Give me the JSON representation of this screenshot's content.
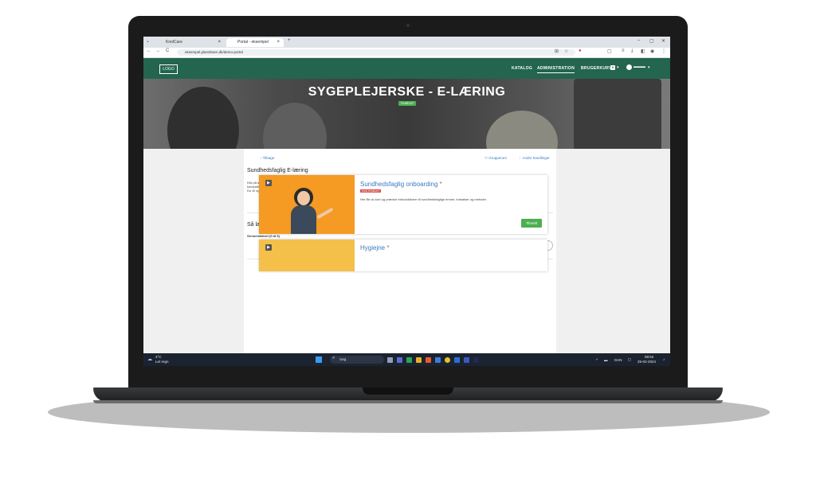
{
  "browser": {
    "tabs": [
      {
        "label": "Knol⁠Care",
        "close": "×"
      },
      {
        "label": "Portal - eksempel",
        "close": "×"
      }
    ],
    "new_tab": "+",
    "window_controls": [
      "–",
      "▢",
      "✕"
    ],
    "nav": {
      "back": "←",
      "forward": "→",
      "reload": "C"
    },
    "url": "eksempel.plan2learn.dk/demo-portal"
  },
  "site": {
    "logo": "LOGO",
    "nav": [
      {
        "label": "KATALOG"
      },
      {
        "label": "ADMINISTRATION"
      },
      {
        "label": "BRUGERKURV"
      }
    ],
    "cart_count": "0",
    "user": "▬▬▬",
    "hero_title": "SYGEPLEJERSKE - E-LÆRING",
    "hero_badge": "TILMELDT",
    "back_link": "‹ Tilbage",
    "group_link": "Grupperum",
    "other_actions": "Andre handlinger",
    "page_title": "Sundhedsfaglig E-læring",
    "intro_line1": "Klik på afspil for at se e-læring, der er gjort klar til dig og passer med emnet i dit",
    "intro_line2": "kompetencekort.",
    "intro_line3": "Du vil også modtage en mail med et link, med direkte adgang til din e-læring.",
    "progress_heading": "Så langt er du",
    "progress_label": "Gennemførsel (0 af 3)",
    "progress_fraction": 0.0,
    "courses": [
      {
        "title": "Sundhedsfaglig onboarding",
        "required": "*",
        "badge": "IKKE TILMELDT",
        "description": "Her får du kort og præcise introduktioner til sundhedsfaglige emner, indsatser og metoder.",
        "button": "Tilmeld"
      },
      {
        "title": "Hygiejne",
        "required": "*"
      }
    ]
  },
  "taskbar": {
    "weather_temp": "4°C",
    "weather_desc": "Let regn",
    "search_placeholder": "Søg",
    "lang": "DAN",
    "time": "08:52",
    "date": "25-02-2024"
  },
  "colors": {
    "nav_green": "#23654f",
    "accent_orange": "#f59a23",
    "link_blue": "#3a7bbf",
    "button_green": "#4caf50"
  }
}
